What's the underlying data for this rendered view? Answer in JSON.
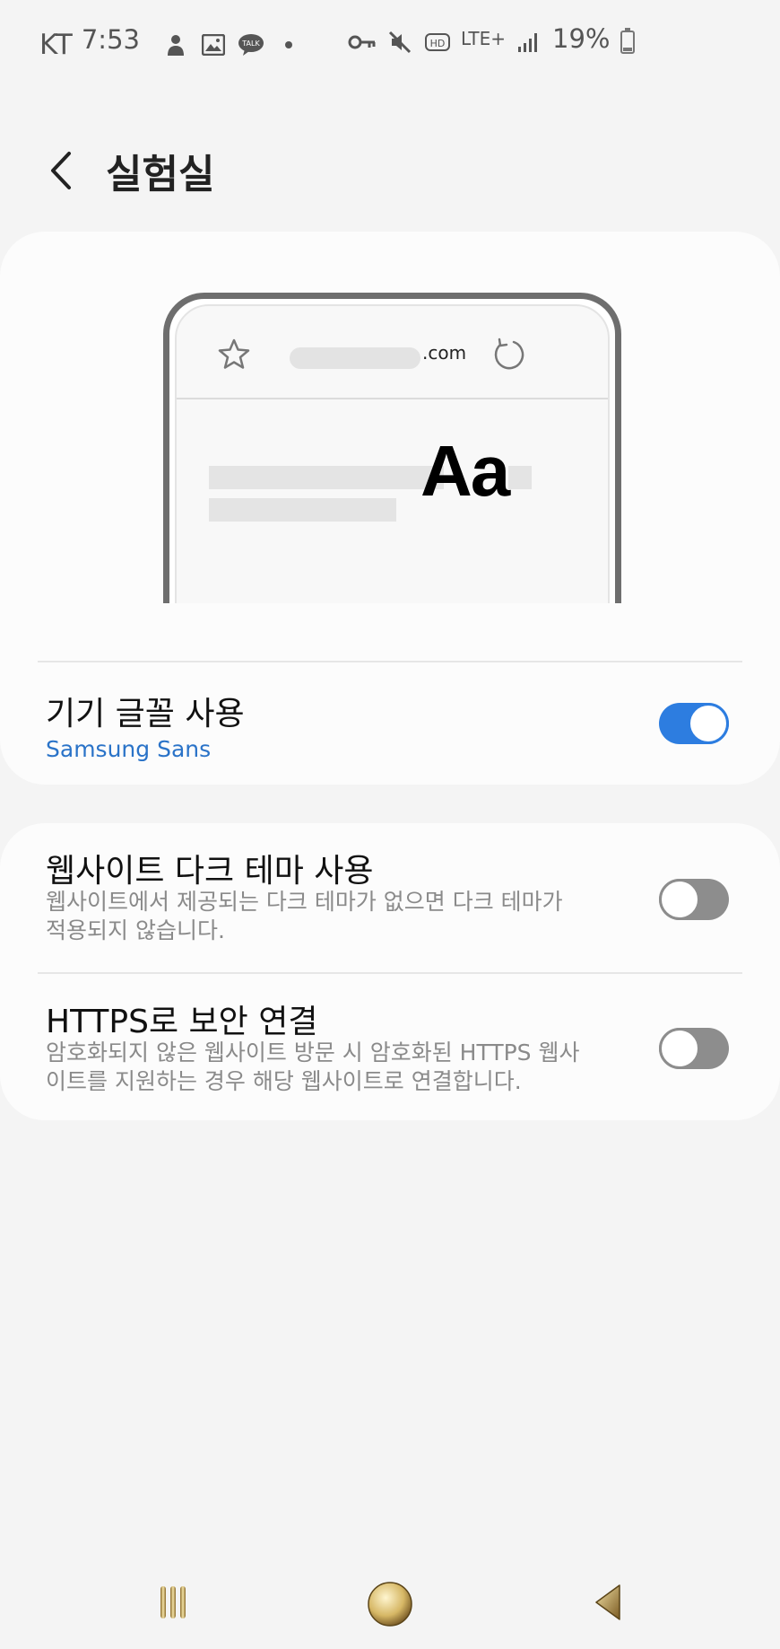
{
  "status_bar": {
    "carrier": "KT",
    "time": "7:53",
    "network": "LTE+",
    "battery_percent": "19%",
    "icons": [
      "person-icon",
      "gallery-icon",
      "talk-icon",
      "dot-icon",
      "key-icon",
      "mute-icon",
      "hd-icon",
      "lte-icon",
      "signal-icon",
      "battery-icon"
    ],
    "talk_label": "TALK",
    "hd_label": "HD"
  },
  "header": {
    "back_icon": "chevron-left-icon",
    "title": "실험실"
  },
  "preview": {
    "domain_suffix": ".com",
    "sample_text": "Aa",
    "icons": [
      "star-icon",
      "reload-icon"
    ]
  },
  "settings": {
    "device_font": {
      "title": "기기 글꼴 사용",
      "subtitle": "Samsung Sans",
      "enabled": true
    },
    "dark_theme": {
      "title": "웹사이트 다크 테마 사용",
      "description": "웹사이트에서 제공되는 다크 테마가 없으면 다크 테마가 적용되지 않습니다.",
      "enabled": false
    },
    "https_connect": {
      "title": "HTTPS로 보안 연결",
      "description": "암호화되지 않은 웹사이트 방문 시 암호화된 HTTPS 웹사이트를 지원하는 경우 해당 웹사이트로 연결합니다.",
      "enabled": false
    }
  },
  "colors": {
    "accent": "#2d7de0",
    "subtitle_blue": "#2a73c8",
    "toggle_off": "#8d8d8d",
    "background": "#f4f4f4",
    "card": "#fcfcfc"
  },
  "nav_bar": {
    "icons": [
      "recent-apps-icon",
      "home-icon",
      "back-icon"
    ]
  }
}
